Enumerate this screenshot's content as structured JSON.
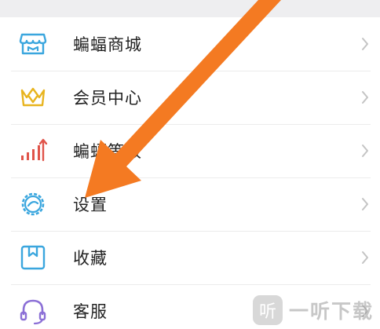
{
  "menu": {
    "items": [
      {
        "label": "蝙蝠商城",
        "icon": "store-icon"
      },
      {
        "label": "会员中心",
        "icon": "crown-icon"
      },
      {
        "label": "蝙蝠等级",
        "icon": "level-chart-icon"
      },
      {
        "label": "设置",
        "icon": "gear-icon"
      },
      {
        "label": "收藏",
        "icon": "bookmark-icon"
      },
      {
        "label": "客服",
        "icon": "headset-icon"
      }
    ]
  },
  "watermark": {
    "badge": "听",
    "text": "一听下载"
  },
  "colors": {
    "accent_blue": "#3aa6de",
    "crown_yellow": "#e8b41e",
    "level_red": "#e0544a",
    "arrow_orange": "#f47a22",
    "divider": "#ececec"
  }
}
